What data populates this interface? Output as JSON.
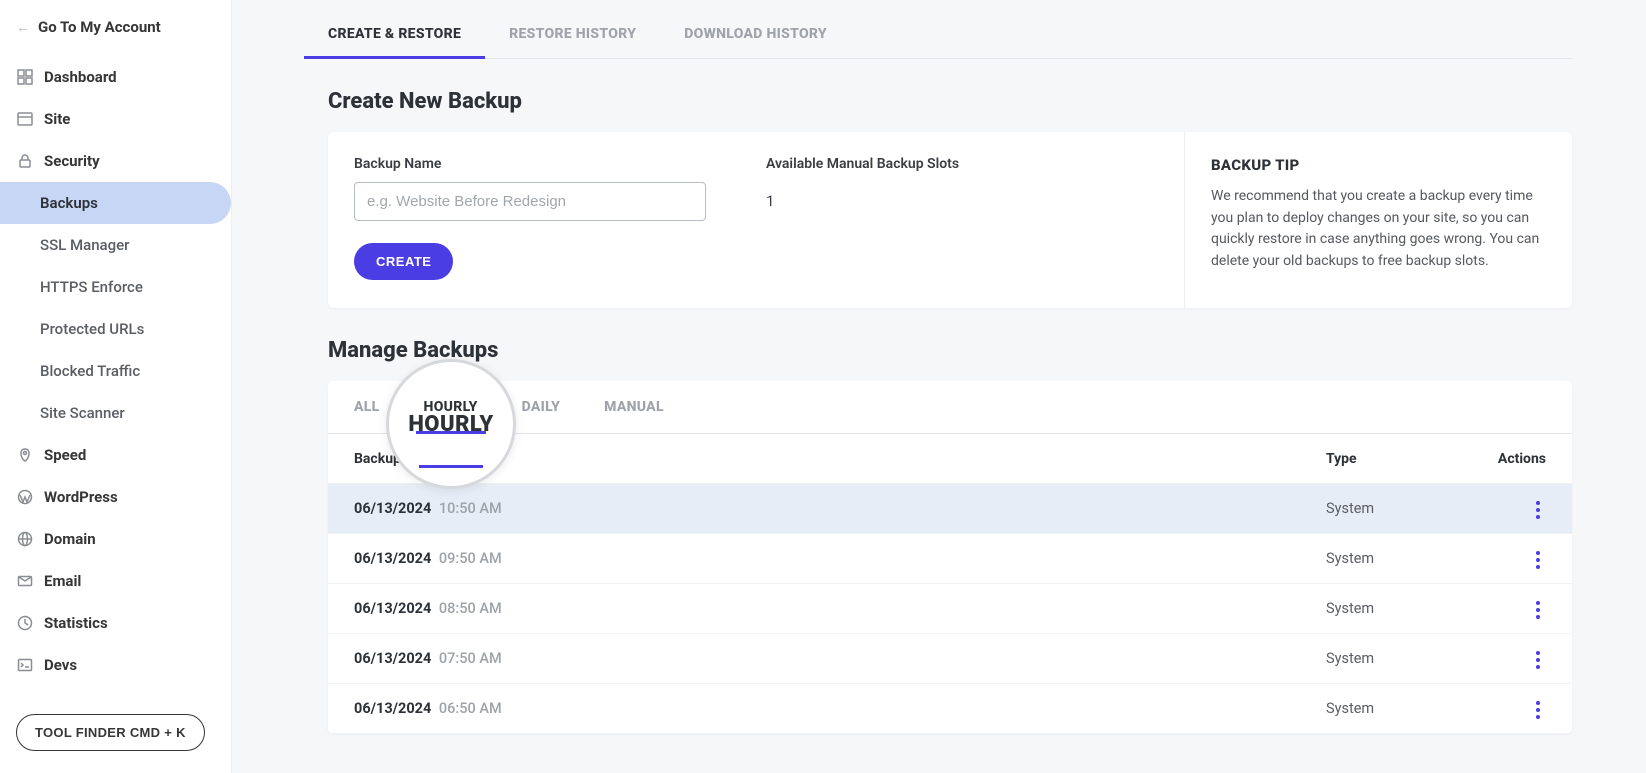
{
  "sidebar": {
    "go_account": "Go To My Account",
    "items": [
      {
        "label": "Dashboard"
      },
      {
        "label": "Site"
      },
      {
        "label": "Security"
      },
      {
        "label": "Speed"
      },
      {
        "label": "WordPress"
      },
      {
        "label": "Domain"
      },
      {
        "label": "Email"
      },
      {
        "label": "Statistics"
      },
      {
        "label": "Devs"
      }
    ],
    "security_sub": [
      {
        "label": "Backups",
        "active": true
      },
      {
        "label": "SSL Manager"
      },
      {
        "label": "HTTPS Enforce"
      },
      {
        "label": "Protected URLs"
      },
      {
        "label": "Blocked Traffic"
      },
      {
        "label": "Site Scanner"
      }
    ],
    "tool_finder": "TOOL FINDER CMD + K"
  },
  "top_tabs": [
    {
      "label": "CREATE & RESTORE",
      "active": true
    },
    {
      "label": "RESTORE HISTORY"
    },
    {
      "label": "DOWNLOAD HISTORY"
    }
  ],
  "create_section": {
    "title": "Create New Backup",
    "name_label": "Backup Name",
    "name_placeholder": "e.g. Website Before Redesign",
    "slots_label": "Available Manual Backup Slots",
    "slots_value": "1",
    "create_btn": "CREATE",
    "tip_title": "BACKUP TIP",
    "tip_text": "We recommend that you create a backup every time you plan to deploy changes on your site, so you can quickly restore in case anything goes wrong. You can delete your old backups to free backup slots."
  },
  "manage_section": {
    "title": "Manage Backups",
    "filter_tabs": [
      {
        "label": "ALL"
      },
      {
        "label": "HOURLY",
        "active": true
      },
      {
        "label": "DAILY"
      },
      {
        "label": "MANUAL"
      }
    ],
    "columns": {
      "backup": "Backup",
      "type": "Type",
      "actions": "Actions"
    },
    "rows": [
      {
        "date": "06/13/2024",
        "time": "10:50 AM",
        "type": "System",
        "highlight": true
      },
      {
        "date": "06/13/2024",
        "time": "09:50 AM",
        "type": "System"
      },
      {
        "date": "06/13/2024",
        "time": "08:50 AM",
        "type": "System"
      },
      {
        "date": "06/13/2024",
        "time": "07:50 AM",
        "type": "System"
      },
      {
        "date": "06/13/2024",
        "time": "06:50 AM",
        "type": "System"
      }
    ],
    "magnifier": "HOURLY"
  }
}
